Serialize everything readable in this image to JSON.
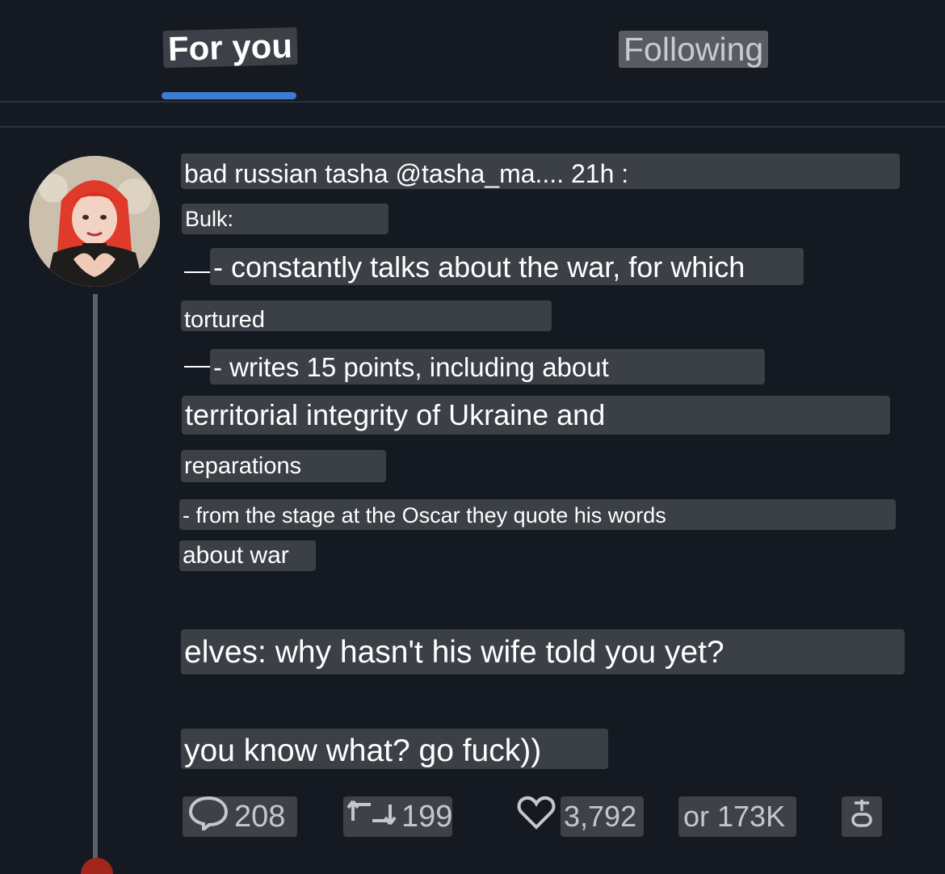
{
  "tabs": [
    {
      "label": "For you",
      "active": true
    },
    {
      "label": "Following",
      "active": false
    }
  ],
  "colors": {
    "background": "#151a22",
    "accent": "#3f7bd1",
    "label_bg": "#3b3f46",
    "text": "#ffffff",
    "muted": "#c4c8cd"
  },
  "post": {
    "header": "bad russian tasha @tasha_ma.... 21h :",
    "lines": [
      "Bulk:",
      "- constantly talks about the war, for which",
      "tortured",
      "- writes 15 points, including about",
      "territorial integrity of Ukraine and",
      "reparations",
      "- from the stage at the Oscar they quote his words",
      "about war",
      "elves: why hasn't his wife told you yet?",
      "you know what? go fuck))"
    ],
    "actions": {
      "replies": "208",
      "reposts": "199",
      "likes": "3,792",
      "views": "or 173K"
    },
    "icons": [
      "reply-icon",
      "repost-icon",
      "like-icon",
      "share-icon"
    ]
  }
}
